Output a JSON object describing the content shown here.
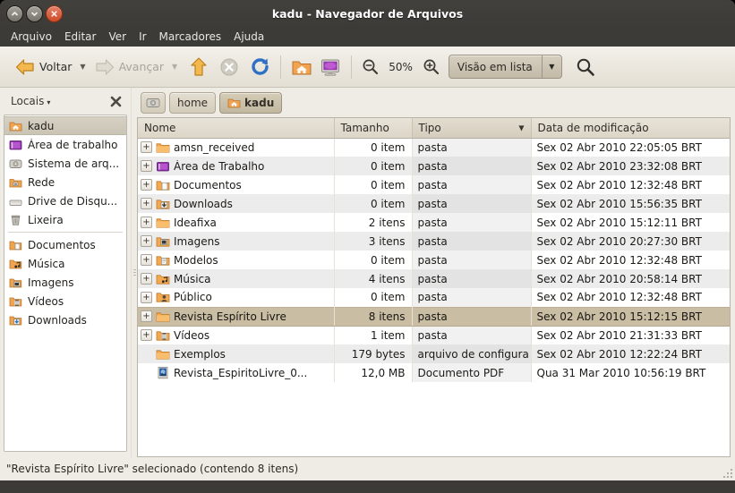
{
  "window": {
    "title": "kadu - Navegador de Arquivos",
    "buttons": {
      "minimize": "minimize",
      "maximize": "maximize",
      "close": "close"
    }
  },
  "menubar": {
    "items": [
      "Arquivo",
      "Editar",
      "Ver",
      "Ir",
      "Marcadores",
      "Ajuda"
    ]
  },
  "toolbar": {
    "back_label": "Voltar",
    "forward_label": "Avançar",
    "dropdown_caret": "▼",
    "up_icon": "up-arrow-icon",
    "stop_icon": "stop-icon",
    "reload_icon": "reload-icon",
    "home_icon": "home-folder-icon",
    "computer_icon": "computer-icon",
    "zoom_out_icon": "zoom-out-icon",
    "zoom_level": "50%",
    "zoom_in_icon": "zoom-in-icon",
    "view_mode": "Visão em lista",
    "view_mode_caret": "▼",
    "search_icon": "search-icon"
  },
  "sidebar": {
    "header_label": "Locais",
    "header_caret": "▾",
    "close_icon": "close-icon",
    "groups": [
      {
        "items": [
          {
            "label": "kadu",
            "icon": "home-folder-icon",
            "active": true
          },
          {
            "label": "Área de trabalho",
            "icon": "desktop-icon",
            "active": false
          },
          {
            "label": "Sistema de arq...",
            "icon": "filesystem-disk-icon",
            "active": false
          },
          {
            "label": "Rede",
            "icon": "network-icon",
            "active": false
          },
          {
            "label": "Drive de Disqu...",
            "icon": "drive-icon",
            "active": false
          },
          {
            "label": "Lixeira",
            "icon": "trash-icon",
            "active": false
          }
        ]
      },
      {
        "items": [
          {
            "label": "Documentos",
            "icon": "documents-folder-icon",
            "active": false
          },
          {
            "label": "Música",
            "icon": "music-folder-icon",
            "active": false
          },
          {
            "label": "Imagens",
            "icon": "pictures-folder-icon",
            "active": false
          },
          {
            "label": "Vídeos",
            "icon": "videos-folder-icon",
            "active": false
          },
          {
            "label": "Downloads",
            "icon": "downloads-folder-icon",
            "active": false
          }
        ]
      }
    ]
  },
  "breadcrumb": {
    "items": [
      {
        "label": "",
        "icon": "filesystem-disk-icon",
        "active": false
      },
      {
        "label": "home",
        "icon": "",
        "active": false
      },
      {
        "label": "kadu",
        "icon": "home-folder-icon",
        "active": true
      }
    ]
  },
  "filelist": {
    "columns": [
      {
        "key": "name",
        "label": "Nome",
        "sorted": false
      },
      {
        "key": "size",
        "label": "Tamanho",
        "sorted": false
      },
      {
        "key": "type",
        "label": "Tipo",
        "sorted": true,
        "sort_arrow": "▼"
      },
      {
        "key": "modified",
        "label": "Data de modificação",
        "sorted": false
      }
    ],
    "rows": [
      {
        "name": "amsn_received",
        "size": "0 item",
        "type": "pasta",
        "modified": "Sex 02 Abr 2010 22:05:05 BRT",
        "icon": "folder-icon",
        "expandable": true,
        "selected": false
      },
      {
        "name": "Área de Trabalho",
        "size": "0 item",
        "type": "pasta",
        "modified": "Sex 02 Abr 2010 23:32:08 BRT",
        "icon": "desktop-folder-icon",
        "expandable": true,
        "selected": false
      },
      {
        "name": "Documentos",
        "size": "0 item",
        "type": "pasta",
        "modified": "Sex 02 Abr 2010 12:32:48 BRT",
        "icon": "documents-folder-icon",
        "expandable": true,
        "selected": false
      },
      {
        "name": "Downloads",
        "size": "0 item",
        "type": "pasta",
        "modified": "Sex 02 Abr 2010 15:56:35 BRT",
        "icon": "downloads-folder-icon",
        "expandable": true,
        "selected": false
      },
      {
        "name": "Ideafixa",
        "size": "2 itens",
        "type": "pasta",
        "modified": "Sex 02 Abr 2010 15:12:11 BRT",
        "icon": "folder-icon",
        "expandable": true,
        "selected": false
      },
      {
        "name": "Imagens",
        "size": "3 itens",
        "type": "pasta",
        "modified": "Sex 02 Abr 2010 20:27:30 BRT",
        "icon": "pictures-folder-icon",
        "expandable": true,
        "selected": false
      },
      {
        "name": "Modelos",
        "size": "0 item",
        "type": "pasta",
        "modified": "Sex 02 Abr 2010 12:32:48 BRT",
        "icon": "templates-folder-icon",
        "expandable": true,
        "selected": false
      },
      {
        "name": "Música",
        "size": "4 itens",
        "type": "pasta",
        "modified": "Sex 02 Abr 2010 20:58:14 BRT",
        "icon": "music-folder-icon",
        "expandable": true,
        "selected": false
      },
      {
        "name": "Público",
        "size": "0 item",
        "type": "pasta",
        "modified": "Sex 02 Abr 2010 12:32:48 BRT",
        "icon": "public-folder-icon",
        "expandable": true,
        "selected": false
      },
      {
        "name": "Revista Espírito Livre",
        "size": "8 itens",
        "type": "pasta",
        "modified": "Sex 02 Abr 2010 15:12:15 BRT",
        "icon": "folder-icon",
        "expandable": true,
        "selected": true
      },
      {
        "name": "Vídeos",
        "size": "1 item",
        "type": "pasta",
        "modified": "Sex 02 Abr 2010 21:31:33 BRT",
        "icon": "videos-folder-icon",
        "expandable": true,
        "selected": false
      },
      {
        "name": "Exemplos",
        "size": "179 bytes",
        "type": "arquivo de configura",
        "modified": "Sex 02 Abr 2010 12:22:24 BRT",
        "icon": "folder-icon",
        "expandable": false,
        "selected": false
      },
      {
        "name": "Revista_EspiritoLivre_0...",
        "size": "12,0 MB",
        "type": "Documento PDF",
        "modified": "Qua 31 Mar 2010 10:56:19 BRT",
        "icon": "pdf-icon",
        "expandable": false,
        "selected": false
      }
    ]
  },
  "statusbar": {
    "text": "\"Revista Espírito Livre\" selecionado (contendo 8 itens)"
  },
  "colors": {
    "titlebar": "#3c3b37",
    "toolbar": "#eae6dd",
    "selection": "#c9bda4",
    "folder_orange": "#f0a33c",
    "accent_blue": "#3465a4"
  }
}
